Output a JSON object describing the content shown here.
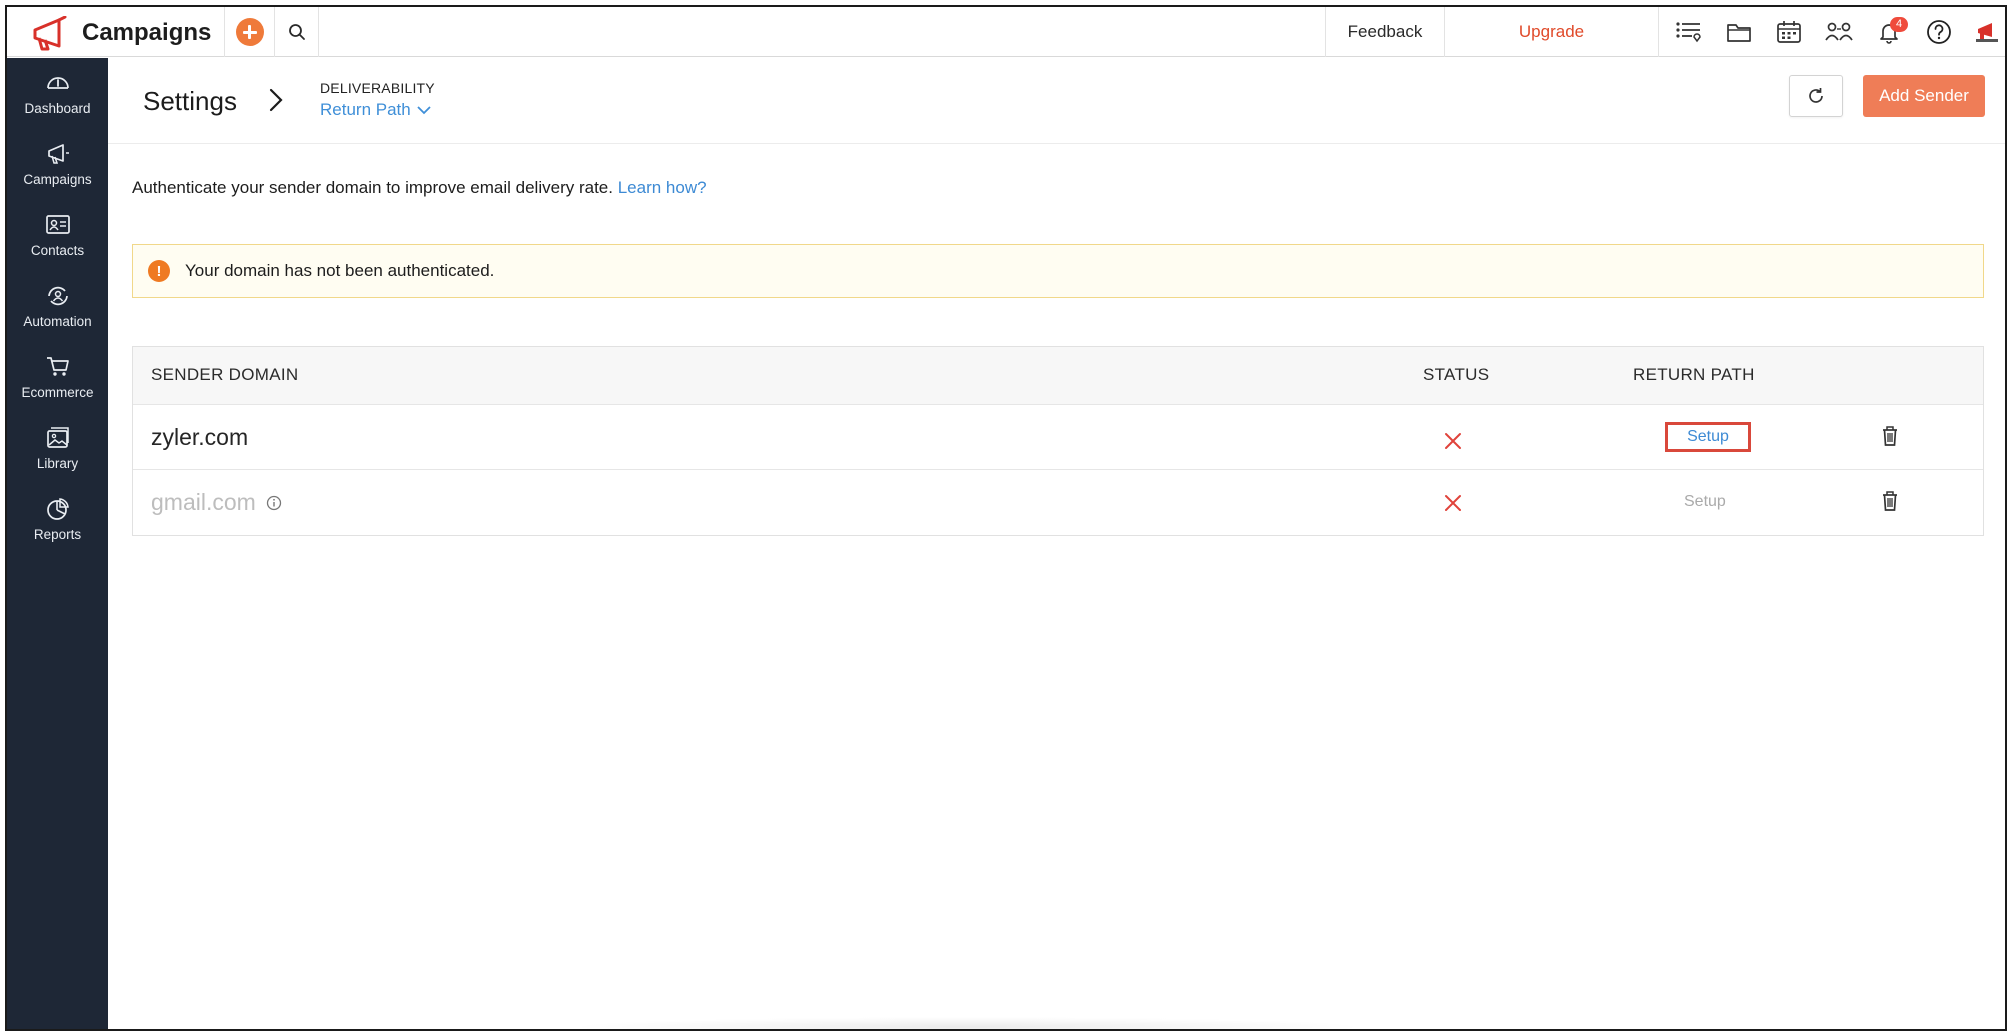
{
  "app": {
    "name": "Campaigns",
    "brand_color": "#d8312a",
    "accent_color": "#ef7a3a"
  },
  "topbar": {
    "feedback_label": "Feedback",
    "upgrade_label": "Upgrade",
    "notification_count": "4",
    "icons": [
      "add-icon",
      "search-icon",
      "checklist-icon",
      "folder-icon",
      "calendar-icon",
      "users-icon",
      "bell-icon",
      "help-icon",
      "profile-icon"
    ]
  },
  "sidebar": {
    "items": [
      {
        "label": "Dashboard",
        "icon": "dashboard-icon"
      },
      {
        "label": "Campaigns",
        "icon": "megaphone-icon"
      },
      {
        "label": "Contacts",
        "icon": "contacts-icon"
      },
      {
        "label": "Automation",
        "icon": "automation-icon"
      },
      {
        "label": "Ecommerce",
        "icon": "cart-icon"
      },
      {
        "label": "Library",
        "icon": "library-icon"
      },
      {
        "label": "Reports",
        "icon": "reports-icon"
      }
    ]
  },
  "header": {
    "title": "Settings",
    "section": "DELIVERABILITY",
    "current": "Return Path",
    "add_sender_label": "Add Sender"
  },
  "info": {
    "text": "Authenticate your sender domain to improve email delivery rate.",
    "link": "Learn how?"
  },
  "alert": {
    "icon_text": "!",
    "text": "Your domain has not been authenticated."
  },
  "table": {
    "columns": [
      "SENDER DOMAIN",
      "STATUS",
      "RETURN PATH"
    ],
    "rows": [
      {
        "domain": "zyler.com",
        "status": "not-authenticated",
        "action": "Setup",
        "enabled": true
      },
      {
        "domain": "gmail.com",
        "status": "not-authenticated",
        "action": "Setup",
        "enabled": false
      }
    ]
  }
}
